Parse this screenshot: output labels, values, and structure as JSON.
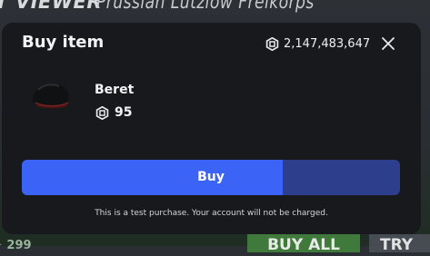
{
  "background": {
    "viewer_title": "IT VIEWER",
    "outfit_name": "Prussian Lutzlow Freikorps",
    "badge_text": "✦ 299",
    "buy_all_label": "BUY ALL",
    "try_label": "TRY"
  },
  "modal": {
    "title": "Buy item",
    "balance": "2,147,483,647",
    "close_icon": "close-icon",
    "currency_icon": "robux-icon",
    "item": {
      "name": "Beret",
      "price": "95"
    },
    "buy_button": {
      "label": "Buy",
      "progress": 0.69
    },
    "disclaimer": "This is a test purchase. Your account will not be charged.",
    "colors": {
      "accent": "#3b63f5",
      "accent_dim": "#2c3e8c",
      "panel": "#17191c"
    }
  }
}
